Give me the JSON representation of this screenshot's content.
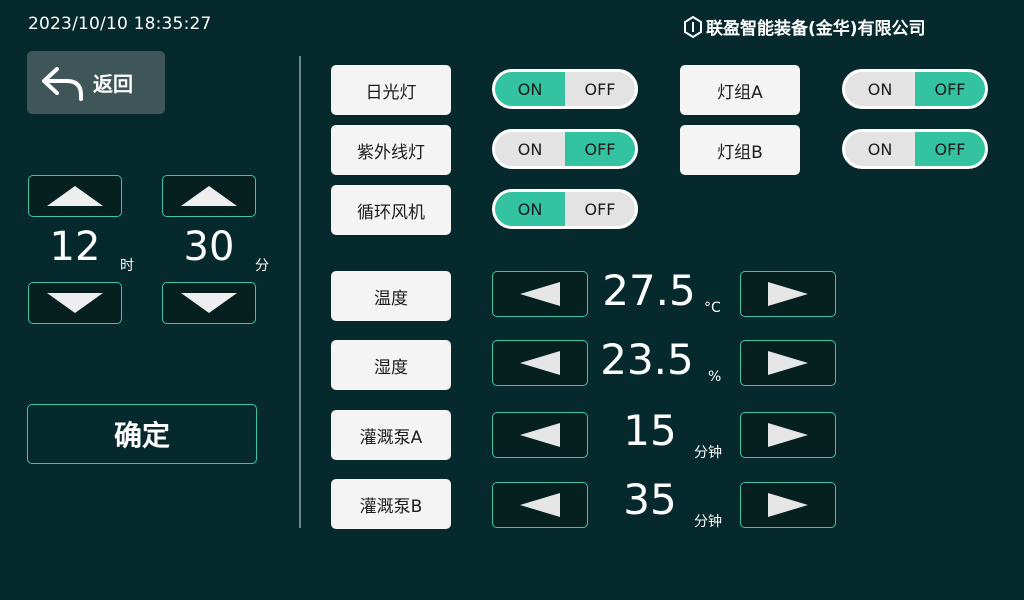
{
  "header": {
    "datetime": "2023/10/10  18:35:27",
    "brand": "联盈智能装备(金华)有限公司",
    "brand_icon": "hexagon-logo-icon"
  },
  "back": {
    "label": "返回",
    "icon": "back-arrow-icon"
  },
  "time_setter": {
    "hour": {
      "value": "12",
      "unit": "时"
    },
    "minute": {
      "value": "30",
      "unit": "分"
    }
  },
  "confirm_label": "确定",
  "toggles": [
    {
      "label": "日光灯",
      "on": "ON",
      "off": "OFF",
      "state": "off"
    },
    {
      "label": "紫外线灯",
      "on": "ON",
      "off": "OFF",
      "state": "on"
    },
    {
      "label": "循环风机",
      "on": "ON",
      "off": "OFF",
      "state": "off"
    },
    {
      "label": "灯组A",
      "on": "ON",
      "off": "OFF",
      "state": "on"
    },
    {
      "label": "灯组B",
      "on": "ON",
      "off": "OFF",
      "state": "on"
    }
  ],
  "params": [
    {
      "label": "温度",
      "value": "27.5",
      "unit": "°C"
    },
    {
      "label": "湿度",
      "value": "23.5",
      "unit": "%"
    },
    {
      "label": "灌溉泵A",
      "value": "15",
      "unit": "分钟"
    },
    {
      "label": "灌溉泵B",
      "value": "35",
      "unit": "分钟"
    }
  ],
  "colors": {
    "background": "#05292c",
    "accent": "#33c3a0",
    "button_border": "#3fc4a5",
    "panel_button": "#3e5658"
  }
}
